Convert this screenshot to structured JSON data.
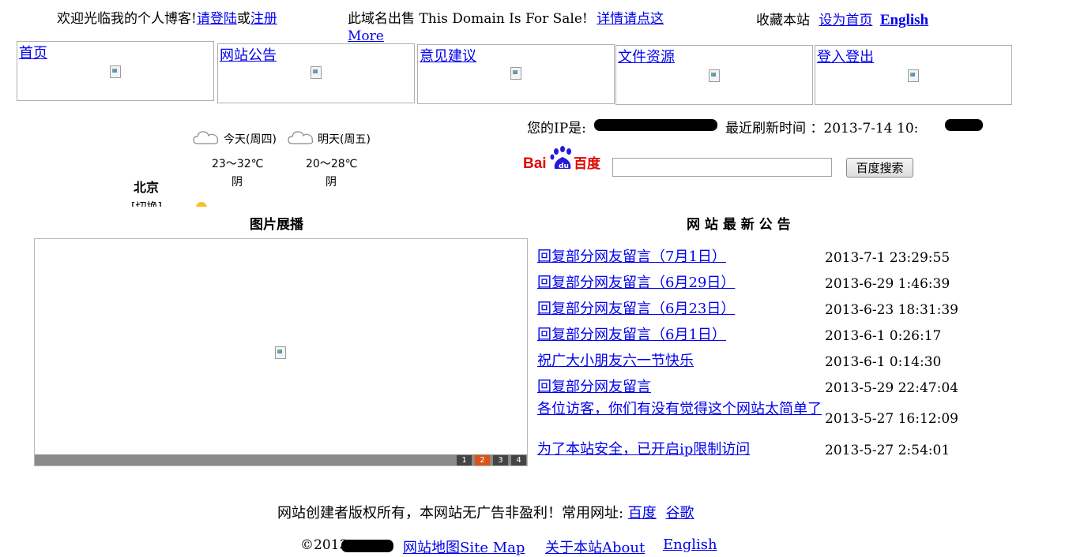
{
  "header": {
    "welcome": "欢迎光临我的个人博客!",
    "login_link": "请登陆",
    "or": "或",
    "register_link": "注册",
    "domain_sale": "此域名出售 This Domain Is For Sale!",
    "details_link": "详情请点这",
    "more_link": "More",
    "bookmark": "收藏本站",
    "set_home_link": "设为首页",
    "english_link": "English"
  },
  "nav": [
    {
      "label": "首页"
    },
    {
      "label": "网站公告"
    },
    {
      "label": "意见建议"
    },
    {
      "label": "文件资源"
    },
    {
      "label": "登入登出"
    }
  ],
  "weather": {
    "city": "北京",
    "switch": "[切换]",
    "today": {
      "label": "今天(周四)",
      "temp": "23～32℃",
      "desc": "阴"
    },
    "tomorrow": {
      "label": "明天(周五)",
      "temp": "20～28℃",
      "desc": "阴"
    }
  },
  "info": {
    "ip_label": "您的IP是:",
    "refresh_label": "最近刷新时间 ：2013-7-14 10:"
  },
  "search": {
    "logo_text": "Bai百度",
    "button": "百度搜索",
    "value": ""
  },
  "slideshow": {
    "title": "图片展播",
    "pages": [
      "1",
      "2",
      "3",
      "4"
    ],
    "active_page": 2
  },
  "notices": {
    "title": "网 站 最 新 公 告",
    "items": [
      {
        "title": "回复部分网友留言（7月1日）",
        "date": "2013-7-1 23:29:55"
      },
      {
        "title": "回复部分网友留言（6月29日）",
        "date": "2013-6-29 1:46:39"
      },
      {
        "title": "回复部分网友留言（6月23日）",
        "date": "2013-6-23 18:31:39"
      },
      {
        "title": "回复部分网友留言（6月1日）",
        "date": "2013-6-1 0:26:17"
      },
      {
        "title": "祝广大小朋友六一节快乐",
        "date": "2013-6-1 0:14:30"
      },
      {
        "title": "回复部分网友留言",
        "date": "2013-5-29 22:47:04"
      },
      {
        "title": "各位访客，你们有没有觉得这个网站太简单了",
        "date": "2013-5-27 16:12:09"
      },
      {
        "title": "为了本站安全，已开启ip限制访问",
        "date": "2013-5-27 2:54:01"
      }
    ]
  },
  "footer": {
    "copyright_text": "网站创建者版权所有，本网站无广告非盈利！常用网址:",
    "baidu_link": "百度",
    "google_link": "谷歌",
    "year": "©2013",
    "sitemap_link": "网站地图Site Map",
    "about_link": "关于本站About",
    "english_link": "English"
  },
  "colors": {
    "link": "#0000ee",
    "slide_active": "#d8541a",
    "slide_bar": "#8a8a8a",
    "redaction": "#000000"
  }
}
